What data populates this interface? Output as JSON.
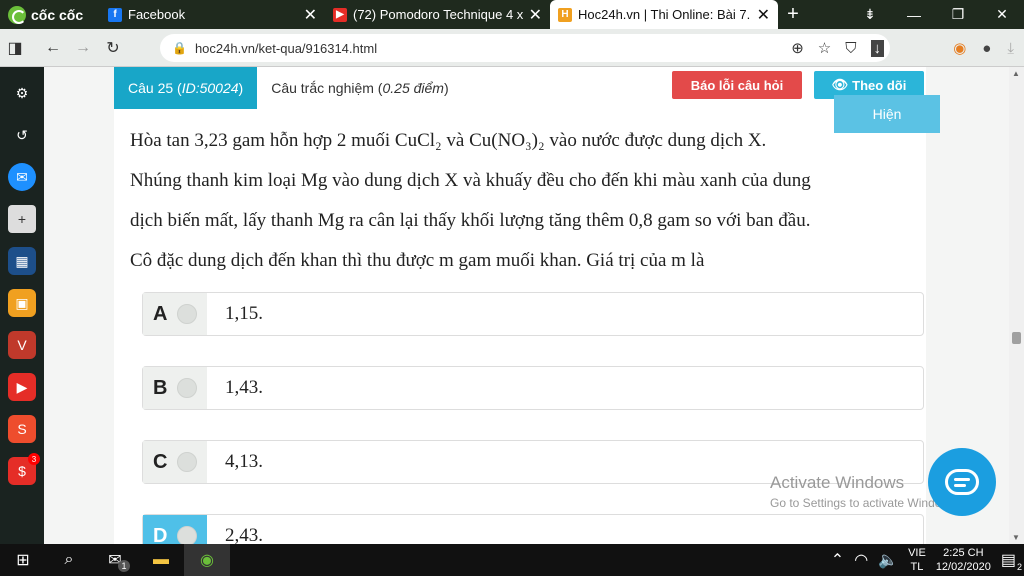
{
  "browser": {
    "brand": "cốc cốc",
    "tabs": [
      {
        "title": "Facebook",
        "icon": "facebook-icon"
      },
      {
        "title": "(72) Pomodoro Technique 4 x",
        "icon": "youtube-icon"
      },
      {
        "title": "Hoc24h.vn | Thi Online: Bài 7.",
        "icon": "hoc24-icon"
      }
    ],
    "new_tab": "+",
    "url": "hoc24h.vn/ket-qua/916314.html"
  },
  "question": {
    "number_label": "Câu 25 (",
    "id_label": "ID:50024",
    "number_suffix": ")",
    "type_label": "Câu trắc nghiệm (",
    "points_label": "0.25 điểm",
    "type_suffix": ")",
    "report_button": "Báo lỗi câu hỏi",
    "follow_button": "Theo dõi",
    "show_button": "Hiện",
    "text_lines": [
      "Hòa tan 3,23 gam hỗn hợp 2 muối CuCl₂ và Cu(NO₃)₂ vào nước được dung dịch X.",
      "Nhúng thanh kim loại Mg vào dung dịch X và khuấy đều cho đến khi màu xanh của dung",
      "dịch biến mất, lấy thanh Mg ra cân lại thấy khối lượng tăng thêm 0,8 gam so với ban đầu.",
      "Cô đặc dung dịch đến khan thì thu được m gam muối khan. Giá trị của m là"
    ],
    "answers": [
      {
        "letter": "A",
        "value": "1,15."
      },
      {
        "letter": "B",
        "value": "1,43."
      },
      {
        "letter": "C",
        "value": "4,13."
      },
      {
        "letter": "D",
        "value": "2,43."
      }
    ]
  },
  "watermark": {
    "line1": "Activate Windows",
    "line2": "Go to Settings to activate Windows."
  },
  "taskbar": {
    "lang_top": "VIE",
    "lang_bottom": "TL",
    "time": "2:25 CH",
    "date": "12/02/2020",
    "notif_count": "2",
    "mail_badge": "1"
  },
  "sidebar": {
    "shopee_badge": "3"
  },
  "colors": {
    "accent": "#18a6c8",
    "report": "#e34a4a",
    "follow": "#2bb5d9",
    "show": "#5bc2e4",
    "tabbar": "#1f2a1e"
  }
}
